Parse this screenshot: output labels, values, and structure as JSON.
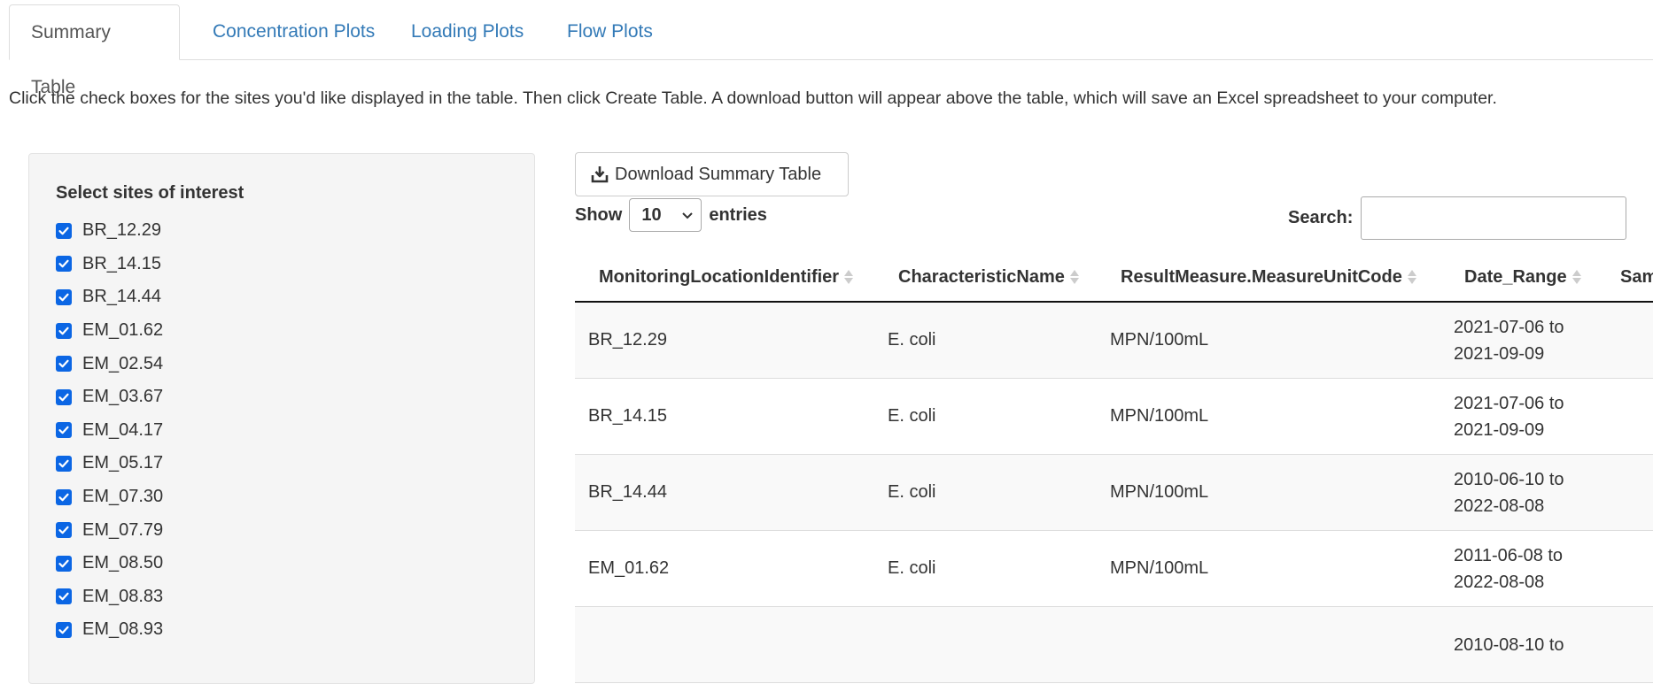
{
  "tabs": [
    {
      "label": "Summary Table",
      "active": true
    },
    {
      "label": "Concentration Plots",
      "active": false
    },
    {
      "label": "Loading Plots",
      "active": false
    },
    {
      "label": "Flow Plots",
      "active": false
    }
  ],
  "instructions": "Click the check boxes for the sites you'd like displayed in the table. Then click Create Table. A download button will appear above the table, which will save an Excel spreadsheet to your computer.",
  "sidebar": {
    "title": "Select sites of interest",
    "sites": [
      {
        "label": "BR_12.29",
        "checked": true
      },
      {
        "label": "BR_14.15",
        "checked": true
      },
      {
        "label": "BR_14.44",
        "checked": true
      },
      {
        "label": "EM_01.62",
        "checked": true
      },
      {
        "label": "EM_02.54",
        "checked": true
      },
      {
        "label": "EM_03.67",
        "checked": true
      },
      {
        "label": "EM_04.17",
        "checked": true
      },
      {
        "label": "EM_05.17",
        "checked": true
      },
      {
        "label": "EM_07.30",
        "checked": true
      },
      {
        "label": "EM_07.79",
        "checked": true
      },
      {
        "label": "EM_08.50",
        "checked": true
      },
      {
        "label": "EM_08.83",
        "checked": true
      },
      {
        "label": "EM_08.93",
        "checked": true
      }
    ]
  },
  "download_button": {
    "label": "Download Summary Table",
    "icon": "download-icon"
  },
  "length_control": {
    "show": "Show",
    "value": "10",
    "entries": "entries"
  },
  "search": {
    "label": "Search:",
    "value": ""
  },
  "table": {
    "columns": [
      "MonitoringLocationIdentifier",
      "CharacteristicName",
      "ResultMeasure.MeasureUnitCode",
      "Date_Range",
      "Sam"
    ],
    "rows": [
      {
        "site": "BR_12.29",
        "characteristic": "E. coli",
        "unit": "MPN/100mL",
        "date_start": "2021-07-06 to",
        "date_end": "2021-09-09"
      },
      {
        "site": "BR_14.15",
        "characteristic": "E. coli",
        "unit": "MPN/100mL",
        "date_start": "2021-07-06 to",
        "date_end": "2021-09-09"
      },
      {
        "site": "BR_14.44",
        "characteristic": "E. coli",
        "unit": "MPN/100mL",
        "date_start": "2010-06-10 to",
        "date_end": "2022-08-08"
      },
      {
        "site": "EM_01.62",
        "characteristic": "E. coli",
        "unit": "MPN/100mL",
        "date_start": "2011-06-08 to",
        "date_end": "2022-08-08"
      },
      {
        "site": "",
        "characteristic": "",
        "unit": "",
        "date_start": "2010-08-10 to",
        "date_end": ""
      }
    ]
  },
  "colors": {
    "link": "#337ab7",
    "checkbox": "#0b66e4",
    "stripe": "#f9f9f9",
    "well": "#f5f5f5"
  }
}
